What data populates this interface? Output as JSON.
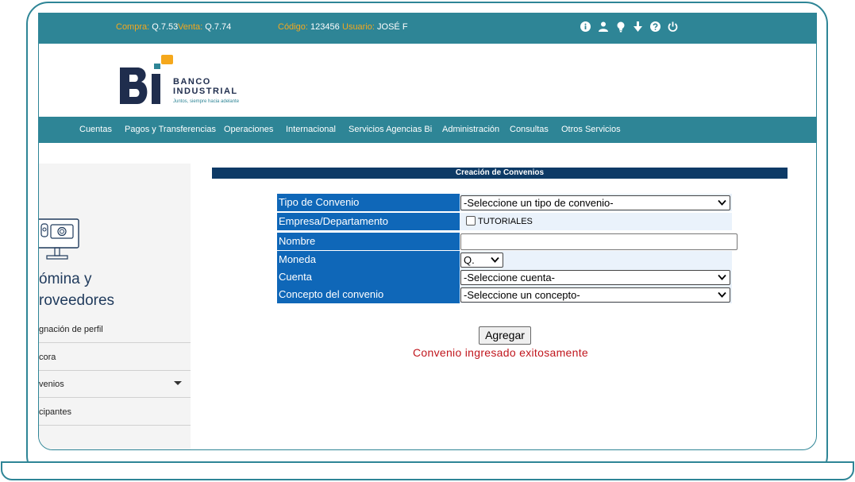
{
  "topbar": {
    "compra_label": "Compra:",
    "compra_value": "Q.7.53",
    "venta_label": "Venta:",
    "venta_value": "Q.7.74",
    "codigo_label": "Código:",
    "codigo_value": "123456",
    "usuario_label": "Usuario:",
    "usuario_value": "JOSÉ F",
    "icons": [
      "info-icon",
      "user-icon",
      "bulb-icon",
      "download-icon",
      "help-icon",
      "power-icon"
    ]
  },
  "brand": {
    "line1": "BANCO",
    "line2": "INDUSTRIAL",
    "tagline": "Juntos, siempre hacia adelante",
    "colors": {
      "navy": "#1f2d4d",
      "teal": "#2e8596",
      "yellow": "#f5a81c"
    }
  },
  "nav": {
    "items": [
      "Cuentas",
      "Pagos y Transferencias",
      "Operaciones",
      "Internacional",
      "Servicios Agencias Bi",
      "Administración",
      "Consultas",
      "Otros Servicios"
    ]
  },
  "sidebar": {
    "title_line1": "ómina y",
    "title_line2": "roveedores",
    "items": [
      "gnación de perfil",
      "cora",
      "venios",
      "cipantes"
    ]
  },
  "form": {
    "header": "Creación de Convenios",
    "tipo_label": "Tipo de Convenio",
    "tipo_value": "-Seleccione un tipo de convenio-",
    "empresa_label": "Empresa/Departamento",
    "empresa_checkbox_label": "TUTORIALES",
    "nombre_label": "Nombre",
    "nombre_value": "",
    "moneda_label": "Moneda",
    "moneda_value": "Q.",
    "cuenta_label": "Cuenta",
    "cuenta_value": "-Seleccione cuenta-",
    "concepto_label": "Concepto del convenio",
    "concepto_value": "-Seleccione un concepto-",
    "add_button": "Agregar",
    "success_message": "Convenio ingresado exitosamente"
  },
  "colors": {
    "primary_teal": "#2e8596",
    "header_navy": "#0d3a66",
    "label_blue": "#0f67b8",
    "accent_orange": "#f5a81c",
    "success_red": "#c0161d"
  }
}
